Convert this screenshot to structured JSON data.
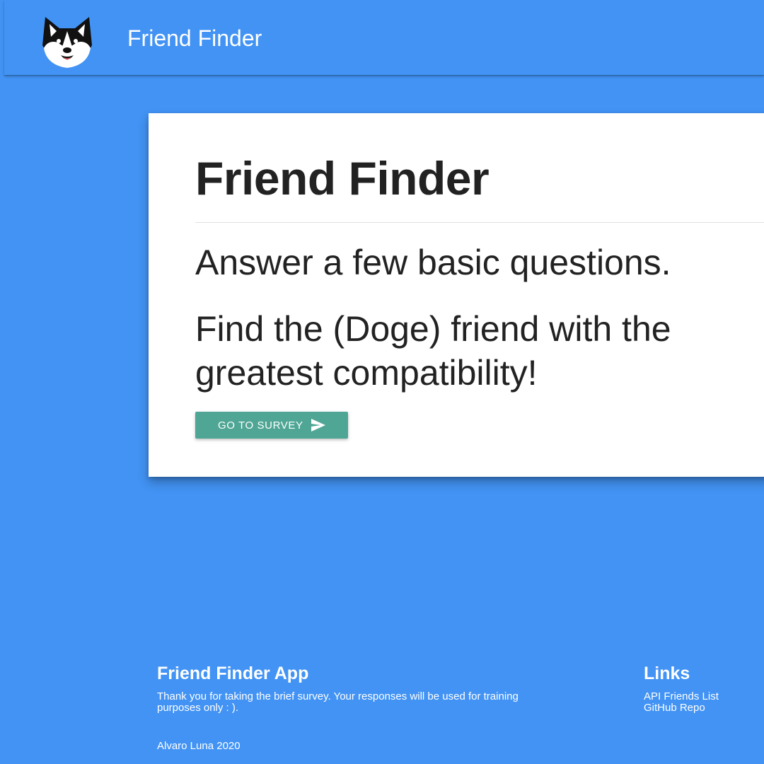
{
  "navbar": {
    "brand": "Friend Finder",
    "logo_icon": "shiba-doge-logo-icon"
  },
  "card": {
    "title": "Friend Finder",
    "lead_line1": "Answer a few basic questions.",
    "lead_line2": "Find the (Doge) friend with the greatest compatibility!",
    "button_label": "GO TO SURVEY",
    "button_icon": "send-icon"
  },
  "footer": {
    "title": "Friend Finder App",
    "text": "Thank you for taking the brief survey. Your responses will be used for training purposes only : ).",
    "credit": "Alvaro Luna 2020",
    "links_title": "Links",
    "links": [
      "API Friends List",
      "GitHub Repo"
    ]
  },
  "colors": {
    "background": "#4293f4",
    "card": "#ffffff",
    "button": "#4fa695",
    "text_dark": "#222222"
  }
}
